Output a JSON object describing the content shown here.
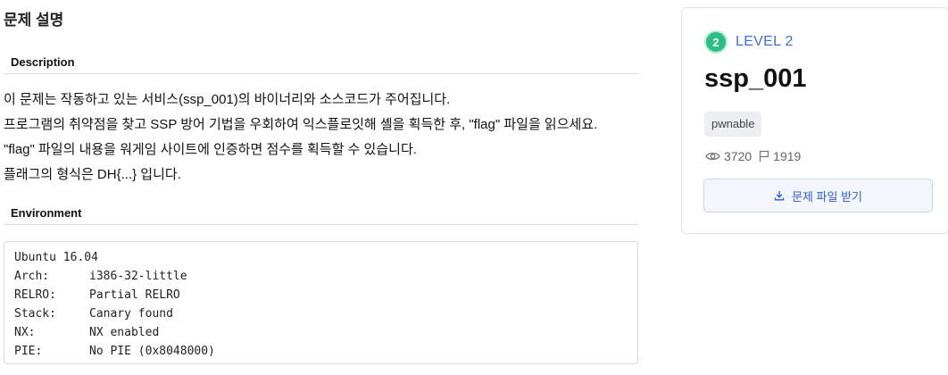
{
  "page_title": "문제 설명",
  "sections": {
    "description_label": "Description",
    "environment_label": "Environment"
  },
  "description": [
    "이 문제는 작동하고 있는 서비스(ssp_001)의 바이너리와 소스코드가 주어집니다.",
    "프로그램의 취약점을 찾고 SSP 방어 기법을 우회하여 익스플로잇해 셸을 획득한 후, \"flag\" 파일을 읽으세요.",
    "\"flag\" 파일의 내용을 워게임 사이트에 인증하면 점수를 획득할 수 있습니다.",
    "플래그의 형식은 DH{...} 입니다."
  ],
  "environment": [
    {
      "key": "Ubuntu 16.04",
      "value": ""
    },
    {
      "key": "Arch:",
      "value": "i386-32-little"
    },
    {
      "key": "RELRO:",
      "value": "Partial RELRO"
    },
    {
      "key": "Stack:",
      "value": "Canary found"
    },
    {
      "key": "NX:",
      "value": "NX enabled"
    },
    {
      "key": "PIE:",
      "value": "No PIE (0x8048000)"
    }
  ],
  "card": {
    "level_number": "2",
    "level_label": "LEVEL 2",
    "title": "ssp_001",
    "tag": "pwnable",
    "views": "3720",
    "solves": "1919",
    "download_label": "문제 파일 받기",
    "colors": {
      "level_badge": "#2bbf86",
      "level_text": "#3f6ee0",
      "button_text": "#2f5bd1"
    },
    "icons": {
      "views": "eye-icon",
      "solves": "flag-icon",
      "download": "download-icon"
    }
  }
}
